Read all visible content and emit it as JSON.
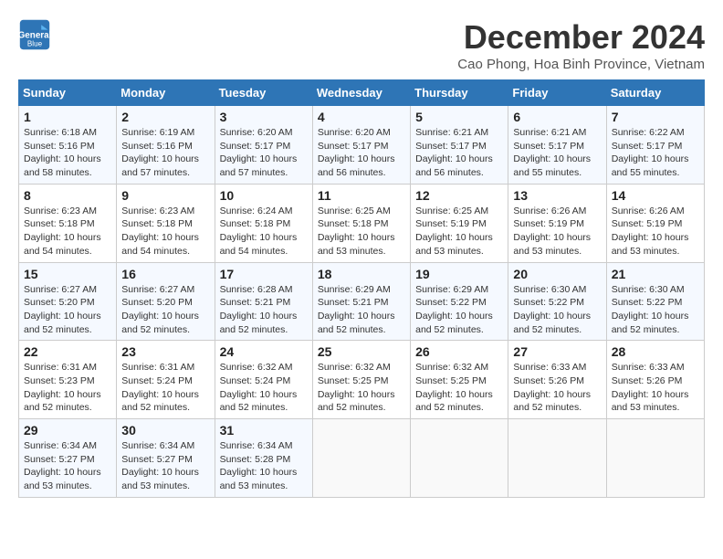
{
  "header": {
    "logo_line1": "General",
    "logo_line2": "Blue",
    "month_title": "December 2024",
    "location": "Cao Phong, Hoa Binh Province, Vietnam"
  },
  "weekdays": [
    "Sunday",
    "Monday",
    "Tuesday",
    "Wednesday",
    "Thursday",
    "Friday",
    "Saturday"
  ],
  "weeks": [
    [
      {
        "day": "1",
        "sunrise": "6:18 AM",
        "sunset": "5:16 PM",
        "daylight": "10 hours and 58 minutes."
      },
      {
        "day": "2",
        "sunrise": "6:19 AM",
        "sunset": "5:16 PM",
        "daylight": "10 hours and 57 minutes."
      },
      {
        "day": "3",
        "sunrise": "6:20 AM",
        "sunset": "5:17 PM",
        "daylight": "10 hours and 57 minutes."
      },
      {
        "day": "4",
        "sunrise": "6:20 AM",
        "sunset": "5:17 PM",
        "daylight": "10 hours and 56 minutes."
      },
      {
        "day": "5",
        "sunrise": "6:21 AM",
        "sunset": "5:17 PM",
        "daylight": "10 hours and 56 minutes."
      },
      {
        "day": "6",
        "sunrise": "6:21 AM",
        "sunset": "5:17 PM",
        "daylight": "10 hours and 55 minutes."
      },
      {
        "day": "7",
        "sunrise": "6:22 AM",
        "sunset": "5:17 PM",
        "daylight": "10 hours and 55 minutes."
      }
    ],
    [
      {
        "day": "8",
        "sunrise": "6:23 AM",
        "sunset": "5:18 PM",
        "daylight": "10 hours and 54 minutes."
      },
      {
        "day": "9",
        "sunrise": "6:23 AM",
        "sunset": "5:18 PM",
        "daylight": "10 hours and 54 minutes."
      },
      {
        "day": "10",
        "sunrise": "6:24 AM",
        "sunset": "5:18 PM",
        "daylight": "10 hours and 54 minutes."
      },
      {
        "day": "11",
        "sunrise": "6:25 AM",
        "sunset": "5:18 PM",
        "daylight": "10 hours and 53 minutes."
      },
      {
        "day": "12",
        "sunrise": "6:25 AM",
        "sunset": "5:19 PM",
        "daylight": "10 hours and 53 minutes."
      },
      {
        "day": "13",
        "sunrise": "6:26 AM",
        "sunset": "5:19 PM",
        "daylight": "10 hours and 53 minutes."
      },
      {
        "day": "14",
        "sunrise": "6:26 AM",
        "sunset": "5:19 PM",
        "daylight": "10 hours and 53 minutes."
      }
    ],
    [
      {
        "day": "15",
        "sunrise": "6:27 AM",
        "sunset": "5:20 PM",
        "daylight": "10 hours and 52 minutes."
      },
      {
        "day": "16",
        "sunrise": "6:27 AM",
        "sunset": "5:20 PM",
        "daylight": "10 hours and 52 minutes."
      },
      {
        "day": "17",
        "sunrise": "6:28 AM",
        "sunset": "5:21 PM",
        "daylight": "10 hours and 52 minutes."
      },
      {
        "day": "18",
        "sunrise": "6:29 AM",
        "sunset": "5:21 PM",
        "daylight": "10 hours and 52 minutes."
      },
      {
        "day": "19",
        "sunrise": "6:29 AM",
        "sunset": "5:22 PM",
        "daylight": "10 hours and 52 minutes."
      },
      {
        "day": "20",
        "sunrise": "6:30 AM",
        "sunset": "5:22 PM",
        "daylight": "10 hours and 52 minutes."
      },
      {
        "day": "21",
        "sunrise": "6:30 AM",
        "sunset": "5:22 PM",
        "daylight": "10 hours and 52 minutes."
      }
    ],
    [
      {
        "day": "22",
        "sunrise": "6:31 AM",
        "sunset": "5:23 PM",
        "daylight": "10 hours and 52 minutes."
      },
      {
        "day": "23",
        "sunrise": "6:31 AM",
        "sunset": "5:24 PM",
        "daylight": "10 hours and 52 minutes."
      },
      {
        "day": "24",
        "sunrise": "6:32 AM",
        "sunset": "5:24 PM",
        "daylight": "10 hours and 52 minutes."
      },
      {
        "day": "25",
        "sunrise": "6:32 AM",
        "sunset": "5:25 PM",
        "daylight": "10 hours and 52 minutes."
      },
      {
        "day": "26",
        "sunrise": "6:32 AM",
        "sunset": "5:25 PM",
        "daylight": "10 hours and 52 minutes."
      },
      {
        "day": "27",
        "sunrise": "6:33 AM",
        "sunset": "5:26 PM",
        "daylight": "10 hours and 52 minutes."
      },
      {
        "day": "28",
        "sunrise": "6:33 AM",
        "sunset": "5:26 PM",
        "daylight": "10 hours and 53 minutes."
      }
    ],
    [
      {
        "day": "29",
        "sunrise": "6:34 AM",
        "sunset": "5:27 PM",
        "daylight": "10 hours and 53 minutes."
      },
      {
        "day": "30",
        "sunrise": "6:34 AM",
        "sunset": "5:27 PM",
        "daylight": "10 hours and 53 minutes."
      },
      {
        "day": "31",
        "sunrise": "6:34 AM",
        "sunset": "5:28 PM",
        "daylight": "10 hours and 53 minutes."
      },
      null,
      null,
      null,
      null
    ]
  ]
}
